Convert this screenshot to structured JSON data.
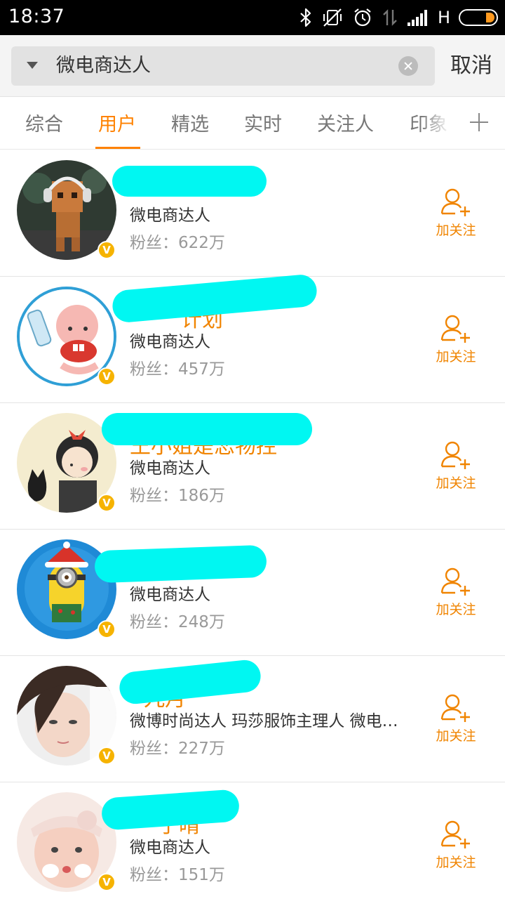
{
  "status_bar": {
    "time": "18:37",
    "network_label": "H",
    "icons": [
      "bluetooth-icon",
      "vibrate-off-icon",
      "alarm-icon",
      "data-arrows-icon",
      "signal-icon",
      "battery-icon"
    ]
  },
  "search": {
    "query": "微电商达人",
    "cancel_label": "取消"
  },
  "tabs": [
    {
      "label": "综合",
      "active": false
    },
    {
      "label": "用户",
      "active": true
    },
    {
      "label": "精选",
      "active": false
    },
    {
      "label": "实时",
      "active": false
    },
    {
      "label": "关注人",
      "active": false
    },
    {
      "label": "印象",
      "active": false
    }
  ],
  "theme": {
    "accent": "#ff8200",
    "verified": "#f6b300",
    "redaction": "#00f7f2"
  },
  "users": [
    {
      "desc": "微电商达人",
      "fans": "粉丝：622万",
      "follow_label": "加关注",
      "verified_mark": "V",
      "visible_name": ""
    },
    {
      "desc": "微电商达人",
      "fans": "粉丝：457万",
      "follow_label": "加关注",
      "verified_mark": "V",
      "visible_name": "计划"
    },
    {
      "desc": "微电商达人",
      "fans": "粉丝：186万",
      "follow_label": "加关注",
      "verified_mark": "V",
      "visible_name": "王小姐是恋物控"
    },
    {
      "desc": "微电商达人",
      "fans": "粉丝：248万",
      "follow_label": "加关注",
      "verified_mark": "V",
      "visible_name": ""
    },
    {
      "desc": "微博时尚达人 玛莎服饰主理人 微电…",
      "fans": "粉丝：227万",
      "follow_label": "加关注",
      "verified_mark": "V",
      "visible_name": "九月"
    },
    {
      "desc": "微电商达人",
      "fans": "粉丝：151万",
      "follow_label": "加关注",
      "verified_mark": "V",
      "visible_name": "子晴"
    }
  ]
}
